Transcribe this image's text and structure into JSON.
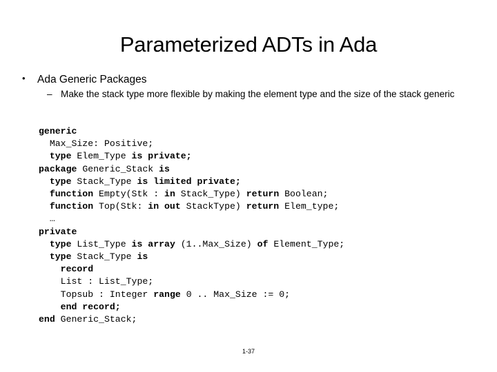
{
  "slide": {
    "title": "Parameterized ADTs in Ada",
    "footer": "1-37",
    "background_color": "#ffffff",
    "text_color": "#000000"
  },
  "bullets": {
    "level1_marker": "•",
    "level2_marker": "–",
    "items": [
      {
        "level": 1,
        "text": "Ada Generic Packages"
      },
      {
        "level": 2,
        "text": "Make the stack type more flexible by making the element type and the size of the stack generic"
      }
    ]
  },
  "code": {
    "language": "Ada",
    "lines": [
      [
        {
          "text": "",
          "bold": false
        },
        {
          "text": "generic",
          "bold": true
        }
      ],
      [
        {
          "text": "  Max_Size: Positive;",
          "bold": false
        }
      ],
      [
        {
          "text": "  ",
          "bold": false
        },
        {
          "text": "type",
          "bold": true
        },
        {
          "text": " Elem_Type ",
          "bold": false
        },
        {
          "text": "is private;",
          "bold": true
        }
      ],
      [
        {
          "text": "package",
          "bold": true
        },
        {
          "text": " Generic_Stack ",
          "bold": false
        },
        {
          "text": "is",
          "bold": true
        }
      ],
      [
        {
          "text": "  ",
          "bold": false
        },
        {
          "text": "type",
          "bold": true
        },
        {
          "text": " Stack_Type ",
          "bold": false
        },
        {
          "text": "is limited private;",
          "bold": true
        }
      ],
      [
        {
          "text": "  ",
          "bold": false
        },
        {
          "text": "function",
          "bold": true
        },
        {
          "text": " Empty(Stk : ",
          "bold": false
        },
        {
          "text": "in",
          "bold": true
        },
        {
          "text": " Stack_Type) ",
          "bold": false
        },
        {
          "text": "return",
          "bold": true
        },
        {
          "text": " Boolean;",
          "bold": false
        }
      ],
      [
        {
          "text": "  ",
          "bold": false
        },
        {
          "text": "function",
          "bold": true
        },
        {
          "text": " Top(Stk: ",
          "bold": false
        },
        {
          "text": "in out",
          "bold": true
        },
        {
          "text": " StackType) ",
          "bold": false
        },
        {
          "text": "return",
          "bold": true
        },
        {
          "text": " Elem_type;",
          "bold": false
        }
      ],
      [
        {
          "text": "  …",
          "bold": false
        }
      ],
      [
        {
          "text": "private",
          "bold": true
        }
      ],
      [
        {
          "text": "  ",
          "bold": false
        },
        {
          "text": "type",
          "bold": true
        },
        {
          "text": " List_Type ",
          "bold": false
        },
        {
          "text": "is array",
          "bold": true
        },
        {
          "text": " (1..Max_Size) ",
          "bold": false
        },
        {
          "text": "of",
          "bold": true
        },
        {
          "text": " Element_Type;",
          "bold": false
        }
      ],
      [
        {
          "text": "  ",
          "bold": false
        },
        {
          "text": "type",
          "bold": true
        },
        {
          "text": " Stack_Type ",
          "bold": false
        },
        {
          "text": "is",
          "bold": true
        }
      ],
      [
        {
          "text": "    ",
          "bold": false
        },
        {
          "text": "record",
          "bold": true
        }
      ],
      [
        {
          "text": "    List : List_Type;",
          "bold": false
        }
      ],
      [
        {
          "text": "    Topsub : Integer ",
          "bold": false
        },
        {
          "text": "range",
          "bold": true
        },
        {
          "text": " 0 .. Max_Size := 0;",
          "bold": false
        }
      ],
      [
        {
          "text": "    ",
          "bold": false
        },
        {
          "text": "end record;",
          "bold": true
        }
      ],
      [
        {
          "text": "end",
          "bold": true
        },
        {
          "text": " Generic_Stack;",
          "bold": false
        }
      ]
    ]
  }
}
